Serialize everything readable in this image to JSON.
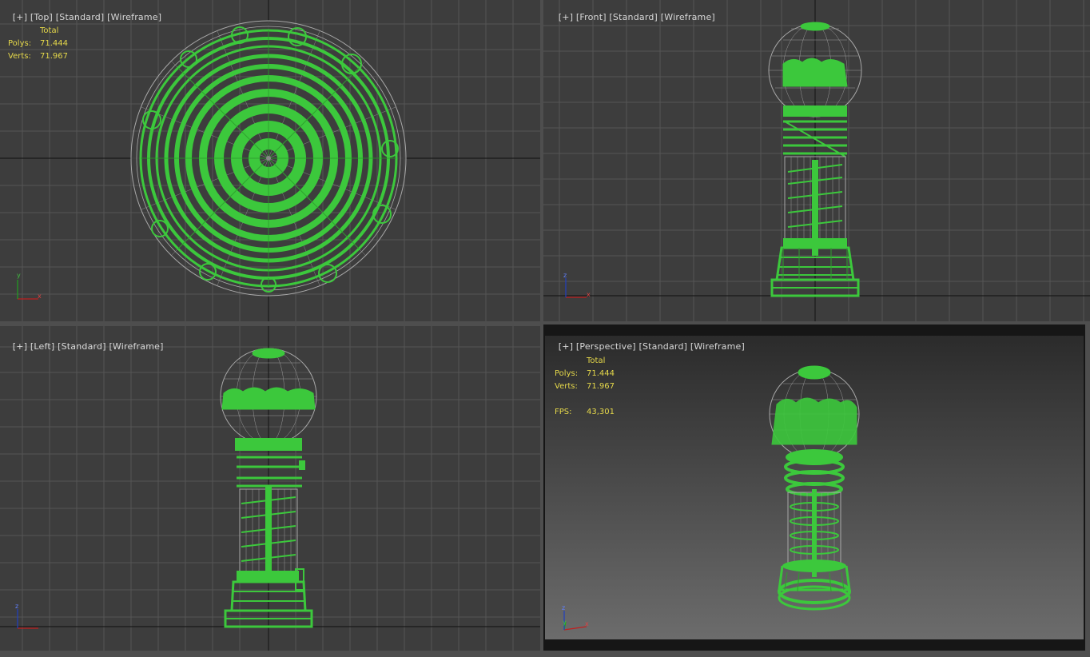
{
  "viewports": {
    "top": {
      "plus": "[+]",
      "view": "[Top]",
      "shading": "[Standard]",
      "mode": "[Wireframe]"
    },
    "front": {
      "plus": "[+]",
      "view": "[Front]",
      "shading": "[Standard]",
      "mode": "[Wireframe]"
    },
    "left": {
      "plus": "[+]",
      "view": "[Left]",
      "shading": "[Standard]",
      "mode": "[Wireframe]"
    },
    "perspective": {
      "plus": "[+]",
      "view": "[Perspective]",
      "shading": "[Standard]",
      "mode": "[Wireframe]"
    }
  },
  "stats_top": {
    "header": "Total",
    "polys_label": "Polys:",
    "polys": "71.444",
    "verts_label": "Verts:",
    "verts": "71.967"
  },
  "stats_persp": {
    "header": "Total",
    "polys_label": "Polys:",
    "polys": "71.444",
    "verts_label": "Verts:",
    "verts": "71.967",
    "fps_label": "FPS:",
    "fps": "43,301"
  },
  "axis": {
    "x": "x",
    "y": "y",
    "z": "z"
  },
  "colors": {
    "wire_green": "#3cc83c",
    "wire_gray": "#a8a8a8",
    "bg": "#3d3d3d",
    "grid": "#5a5a5a",
    "active_border": "#c4b347",
    "stats_text": "#e6d94a"
  }
}
